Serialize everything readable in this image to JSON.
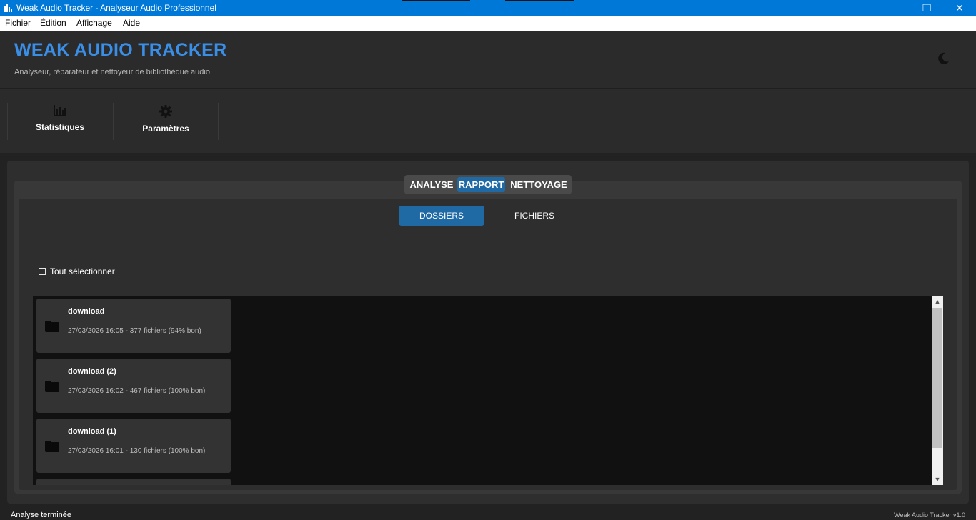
{
  "window": {
    "title": "Weak Audio Tracker - Analyseur Audio Professionnel",
    "minimize_glyph": "—",
    "maximize_glyph": "❐",
    "close_glyph": "✕"
  },
  "menu": {
    "items": [
      {
        "label": "Fichier"
      },
      {
        "label": "Édition"
      },
      {
        "label": "Affichage"
      },
      {
        "label": "Aide"
      }
    ]
  },
  "header": {
    "title": "WEAK AUDIO TRACKER",
    "subtitle": "Analyseur, réparateur et nettoyeur de bibliothèque audio",
    "theme_icon": "moon-icon"
  },
  "toolbar": {
    "items": [
      {
        "label": "Statistiques",
        "icon": "bar-chart-icon"
      },
      {
        "label": "Paramètres",
        "icon": "gear-icon"
      }
    ]
  },
  "tabs": {
    "items": [
      {
        "label": "ANALYSE",
        "active": false
      },
      {
        "label": "RAPPORT",
        "active": true
      },
      {
        "label": "NETTOYAGE",
        "active": false
      }
    ]
  },
  "segments": {
    "dossiers": "DOSSIERS",
    "fichiers": "FICHIERS",
    "selected": "DOSSIERS"
  },
  "select_all": {
    "label": "Tout sélectionner",
    "checked": false
  },
  "folders": [
    {
      "name": "download",
      "meta": "27/03/2026 16:05 - 377 fichiers (94% bon)"
    },
    {
      "name": "download (2)",
      "meta": "27/03/2026 16:02 - 467 fichiers (100% bon)"
    },
    {
      "name": "download (1)",
      "meta": "27/03/2026 16:01 - 130 fichiers (100% bon)"
    }
  ],
  "status": {
    "text": "Analyse terminée",
    "version": "Weak Audio Tracker v1.0"
  },
  "colors": {
    "accent": "#1f6aa5",
    "title_blue": "#3a8ee6",
    "titlebar": "#0078d7"
  }
}
